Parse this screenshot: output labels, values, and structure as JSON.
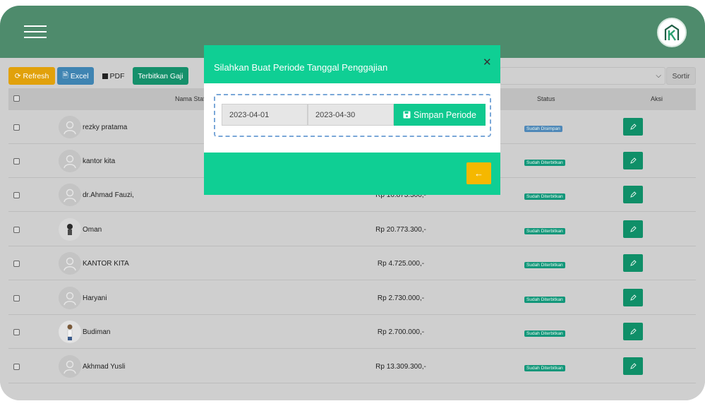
{
  "toolbar": {
    "refresh_label": "Refresh",
    "excel_label": "Excel",
    "pdf_label": "PDF",
    "publish_label": "Terbitkan Gaji",
    "sort_label": "Sortir",
    "sort_select_value": "",
    "colors": {
      "refresh": "#e1a10b",
      "excel": "#3f84b2",
      "pdf": "#cfcfcf",
      "publish": "#15906b"
    }
  },
  "table": {
    "headers": {
      "name": "Nama Staf",
      "status": "Status",
      "action": "Aksi"
    },
    "rows": [
      {
        "name": "rezky pratama",
        "salary": "",
        "status": "Sudah Disimpan",
        "avatar": "placeholder"
      },
      {
        "name": "kantor kita",
        "salary": "",
        "status": "Sudah Diterbitkan",
        "avatar": "placeholder"
      },
      {
        "name": "dr.Ahmad Fauzi,",
        "salary": "Rp 16.873.300,-",
        "status": "Sudah Diterbitkan",
        "avatar": "placeholder"
      },
      {
        "name": "Oman",
        "salary": "Rp 20.773.300,-",
        "status": "Sudah Diterbitkan",
        "avatar": "photo-dark"
      },
      {
        "name": "KANTOR KITA",
        "salary": "Rp 4.725.000,-",
        "status": "Sudah Diterbitkan",
        "avatar": "placeholder"
      },
      {
        "name": "Haryani",
        "salary": "Rp 2.730.000,-",
        "status": "Sudah Diterbitkan",
        "avatar": "placeholder"
      },
      {
        "name": "Budiman",
        "salary": "Rp 2.700.000,-",
        "status": "Sudah Diterbitkan",
        "avatar": "photo-light"
      },
      {
        "name": "Akhmad Yusli",
        "salary": "Rp 13.309.300,-",
        "status": "Sudah Diterbitkan",
        "avatar": "placeholder"
      }
    ]
  },
  "modal": {
    "title": "Silahkan Buat Periode Tanggal Penggajian",
    "start_date": "2023-04-01",
    "end_date": "2023-04-30",
    "save_label": "Simpan Periode",
    "colors": {
      "header": "#0fcf94",
      "back_button": "#f5b800"
    }
  },
  "icons": {
    "menu": "hamburger-icon",
    "logo": "company-logo",
    "close": "close-icon",
    "save": "floppy-disk-icon",
    "back": "arrow-left-icon",
    "edit": "pencil-icon"
  }
}
